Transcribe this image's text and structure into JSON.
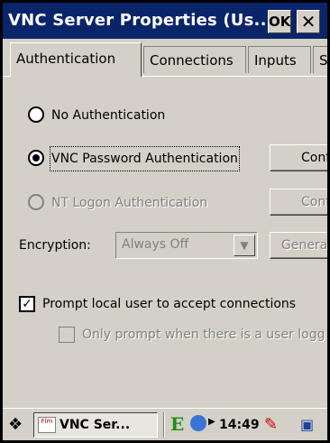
{
  "window": {
    "title": "VNC Server Properties (Us...",
    "ok_label": "OK",
    "close_label": "✕"
  },
  "tabs": [
    {
      "label": "Authentication",
      "active": true
    },
    {
      "label": "Connections",
      "active": false
    },
    {
      "label": "Inputs",
      "active": false
    },
    {
      "label": "S",
      "active": false
    }
  ],
  "auth": {
    "options": [
      {
        "label": "No Authentication",
        "selected": false,
        "enabled": true
      },
      {
        "label": "VNC Password Authentication",
        "selected": true,
        "enabled": true,
        "button_label": "Conf"
      },
      {
        "label": "NT Logon Authentication",
        "selected": false,
        "enabled": false,
        "button_label": "Conf"
      }
    ],
    "encryption_label": "Encryption:",
    "encryption_value": "Always Off",
    "generate_label": "Genera",
    "prompt_checkbox": {
      "label": "Prompt local user to accept connections",
      "checked": true
    },
    "only_prompt_checkbox": {
      "label": "Only prompt when there is a user logg",
      "checked": false,
      "enabled": false
    }
  },
  "taskbar": {
    "task_label": "VNC Ser...",
    "task_icon_text": "Flm",
    "clock": "14:49",
    "e_icon": "E"
  },
  "colors": {
    "titlebar": "#0a246a",
    "face": "#d4d0c8"
  }
}
